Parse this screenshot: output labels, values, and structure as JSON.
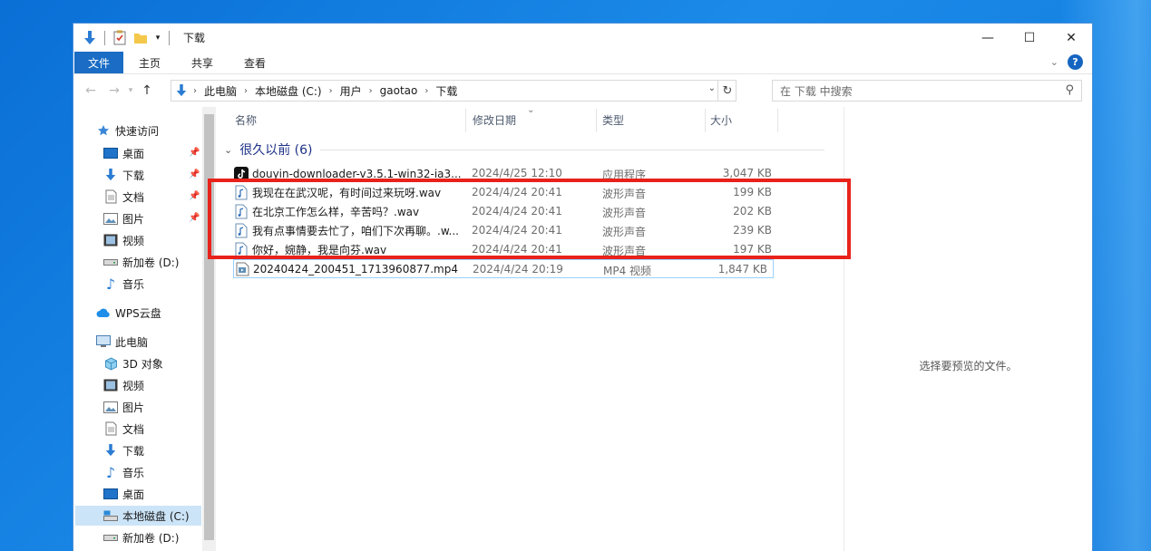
{
  "window": {
    "title": "下载",
    "controls": {
      "minimize": "—",
      "maximize": "☐",
      "close": "✕"
    }
  },
  "ribbon": {
    "tabs": [
      "文件",
      "主页",
      "共享",
      "查看"
    ]
  },
  "address": {
    "crumbs": [
      "此电脑",
      "本地磁盘 (C:)",
      "用户",
      "gaotao",
      "下载"
    ]
  },
  "search": {
    "placeholder": "在 下载 中搜索"
  },
  "nav": {
    "quick_access": "快速访问",
    "items_quick": [
      "桌面",
      "下载",
      "文档",
      "图片",
      "视频",
      "新加卷 (D:)",
      "音乐"
    ],
    "wps": "WPS云盘",
    "this_pc": "此电脑",
    "items_pc": [
      "3D 对象",
      "视频",
      "图片",
      "文档",
      "下载",
      "音乐",
      "桌面",
      "本地磁盘 (C:)",
      "新加卷 (D:)"
    ]
  },
  "columns": {
    "name": "名称",
    "date": "修改日期",
    "type": "类型",
    "size": "大小"
  },
  "group": {
    "label": "很久以前 (6)"
  },
  "files": [
    {
      "name": "douyin-downloader-v3.5.1-win32-ia3...",
      "date": "2024/4/25 12:10",
      "type": "应用程序",
      "size": "3,047 KB",
      "icon": "tiktok-icon"
    },
    {
      "name": "我现在在武汉呢，有时间过来玩呀.wav",
      "date": "2024/4/24 20:41",
      "type": "波形声音",
      "size": "199 KB",
      "icon": "audio-file-icon"
    },
    {
      "name": "在北京工作怎么样，辛苦吗？.wav",
      "date": "2024/4/24 20:41",
      "type": "波形声音",
      "size": "202 KB",
      "icon": "audio-file-icon"
    },
    {
      "name": "我有点事情要去忙了，咱们下次再聊。.w...",
      "date": "2024/4/24 20:41",
      "type": "波形声音",
      "size": "239 KB",
      "icon": "audio-file-icon"
    },
    {
      "name": "你好，婉静，我是向芬.wav",
      "date": "2024/4/24 20:41",
      "type": "波形声音",
      "size": "197 KB",
      "icon": "audio-file-icon"
    },
    {
      "name": "20240424_200451_1713960877.mp4",
      "date": "2024/4/24 20:19",
      "type": "MP4 视频",
      "size": "1,847 KB",
      "icon": "video-file-icon"
    }
  ],
  "preview": {
    "message": "选择要预览的文件。"
  },
  "colors": {
    "file_tab": "#1a6cc5",
    "highlight_box": "#e8221b",
    "group_text": "#1e3287"
  }
}
